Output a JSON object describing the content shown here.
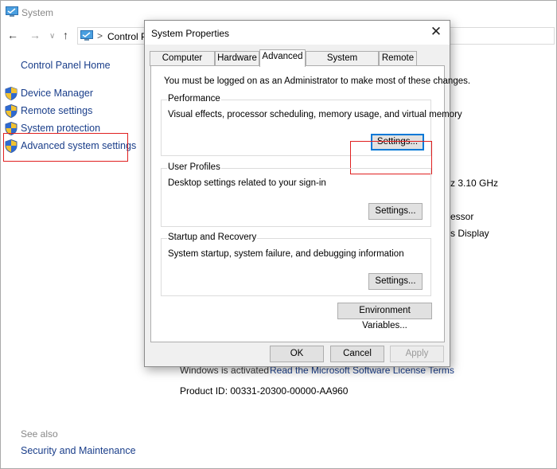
{
  "window": {
    "title": "System",
    "breadcrumb_first": "Control P",
    "colors": {
      "link": "#1a3e8a",
      "highlight": "#e02020",
      "focus": "#0078d7"
    }
  },
  "left_pane": {
    "home": "Control Panel Home",
    "tasks": [
      {
        "label": "Device Manager",
        "icon": "shield-icon"
      },
      {
        "label": "Remote settings",
        "icon": "shield-icon"
      },
      {
        "label": "System protection",
        "icon": "shield-icon"
      },
      {
        "label": "Advanced system settings",
        "icon": "shield-icon"
      }
    ],
    "see_also": "See also",
    "security_maintenance": "Security and Maintenance"
  },
  "background_content": {
    "cpu_speed": "z  3.10 GHz",
    "processor_fragment": "essor",
    "display_fragment": "s Display",
    "activation_status": "Windows is activated",
    "license_link": "Read the Microsoft Software License Terms",
    "product_id": "Product ID:  00331-20300-00000-AA960"
  },
  "dialog": {
    "title": "System Properties",
    "tabs": [
      "Computer Name",
      "Hardware",
      "Advanced",
      "System Protection",
      "Remote"
    ],
    "active_tab": "Advanced",
    "admin_notice": "You must be logged on as an Administrator to make most of these changes.",
    "performance": {
      "title": "Performance",
      "description": "Visual effects, processor scheduling, memory usage, and virtual memory",
      "button": "Settings..."
    },
    "user_profiles": {
      "title": "User Profiles",
      "description": "Desktop settings related to your sign-in",
      "button": "Settings..."
    },
    "startup_recovery": {
      "title": "Startup and Recovery",
      "description": "System startup, system failure, and debugging information",
      "button": "Settings..."
    },
    "env_button": "Environment Variables...",
    "ok": "OK",
    "cancel": "Cancel",
    "apply": "Apply"
  }
}
